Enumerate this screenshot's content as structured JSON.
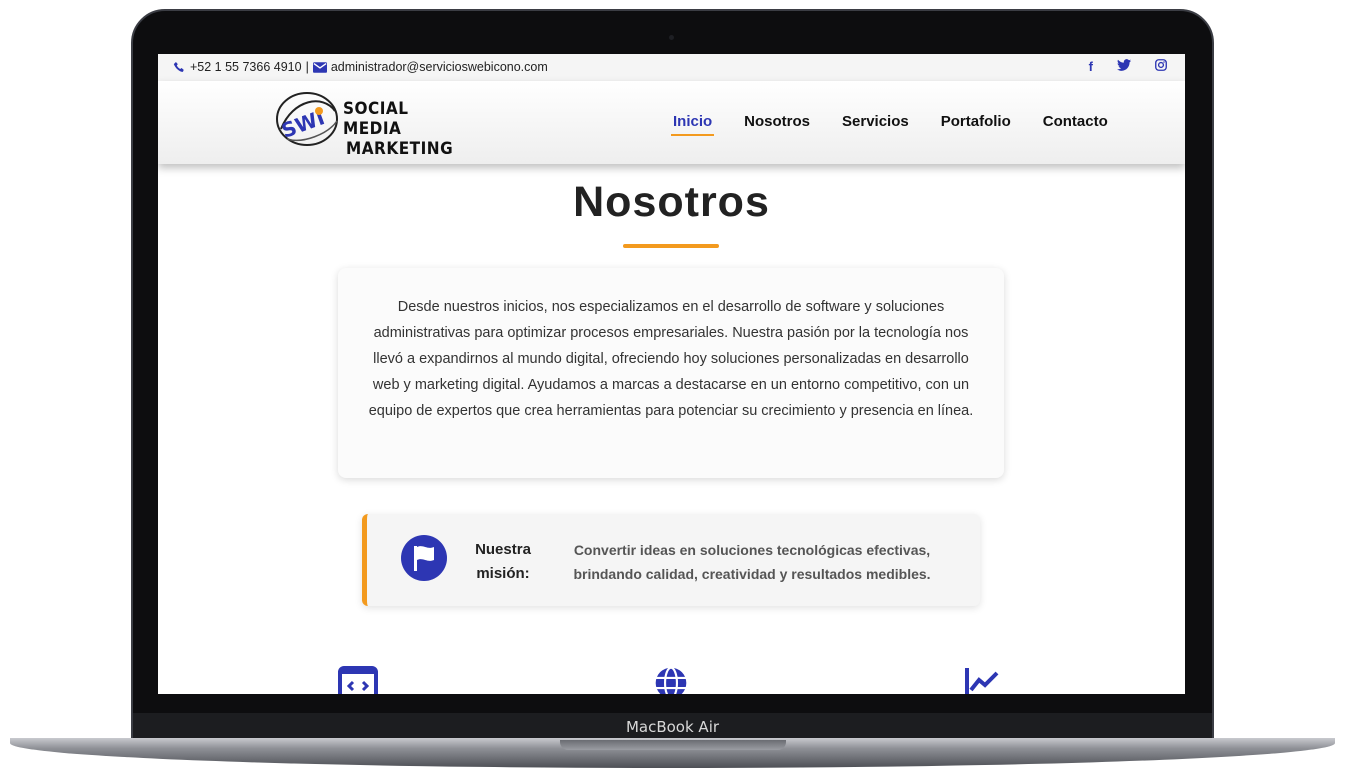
{
  "device": {
    "label": "MacBook Air"
  },
  "topbar": {
    "phone": "+52 1 55 7366 4910",
    "separator": "|",
    "email": "administrador@servicioswebicono.com",
    "social_icons": [
      "facebook-icon",
      "twitter-icon",
      "instagram-icon"
    ]
  },
  "brand": {
    "logo_initials": "SWI",
    "line1": "SOCIAL MEDIA",
    "line2": "MARKETING"
  },
  "nav": {
    "items": [
      "Inicio",
      "Nosotros",
      "Servicios",
      "Portafolio",
      "Contacto"
    ],
    "active": "Inicio"
  },
  "section": {
    "title": "Nosotros",
    "about_text": "Desde nuestros inicios, nos especializamos en el desarrollo de software y soluciones administrativas para optimizar procesos empresariales. Nuestra pasión por la tecnología nos llevó a expandirnos al mundo digital, ofreciendo hoy soluciones personalizadas en desarrollo web y marketing digital. Ayudamos a marcas a destacarse en un entorno competitivo, con un equipo de expertos que crea herramientas para potenciar su crecimiento y presencia en línea."
  },
  "mission": {
    "title": "Nuestra misión:",
    "text": "Convertir ideas en soluciones tecnológicas efectivas, brindando calidad, creatividad y resultados medibles."
  },
  "features": {
    "icons": [
      "code-window-icon",
      "globe-icon",
      "chart-line-icon"
    ]
  },
  "colors": {
    "accent": "#2d36b3",
    "highlight": "#f39a1e"
  }
}
